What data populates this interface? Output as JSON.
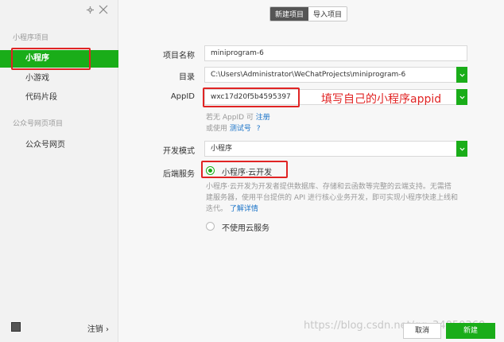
{
  "sidebar": {
    "section_miniprogram": "小程序项目",
    "items": [
      {
        "label": "小程序"
      },
      {
        "label": "小游戏"
      },
      {
        "label": "代码片段"
      }
    ],
    "section_official": "公众号网页项目",
    "official_item": "公众号网页",
    "logout_label": "注销 ›"
  },
  "tabs": [
    {
      "label": "新建项目"
    },
    {
      "label": "导入项目"
    }
  ],
  "form": {
    "name_label": "项目名称",
    "name_value": "miniprogram-6",
    "dir_label": "目录",
    "dir_value": "C:\\Users\\Administrator\\WeChatProjects\\miniprogram-6",
    "appid_label": "AppID",
    "appid_value": "wxc17d20f5b4595397",
    "appid_note_prefix": "若无 AppID 可",
    "appid_register": "注册",
    "appid_note2_prefix": "或使用",
    "appid_test": "测试号",
    "appid_help": "?",
    "mode_label": "开发模式",
    "mode_value": "小程序",
    "backend_label": "后端服务",
    "backend_option1": "小程序·云开发",
    "backend_desc1": "小程序·云开发为开发者提供数据库、存储和云函数等完整的云端支持。无需搭",
    "backend_desc2": "建服务器，使用平台提供的 API 进行核心业务开发，即可实现小程序快速上线和",
    "backend_desc3": "迭代。",
    "backend_more": "了解详情",
    "backend_option2": "不使用云服务"
  },
  "annotation": "填写自己的小程序appid",
  "watermark": "https://blog.csdn.net/qq_34050360",
  "buttons": {
    "cancel": "取消",
    "create": "新建"
  },
  "colors": {
    "accent": "#1aad19",
    "highlight": "#e02424",
    "link": "#1a73c8"
  }
}
